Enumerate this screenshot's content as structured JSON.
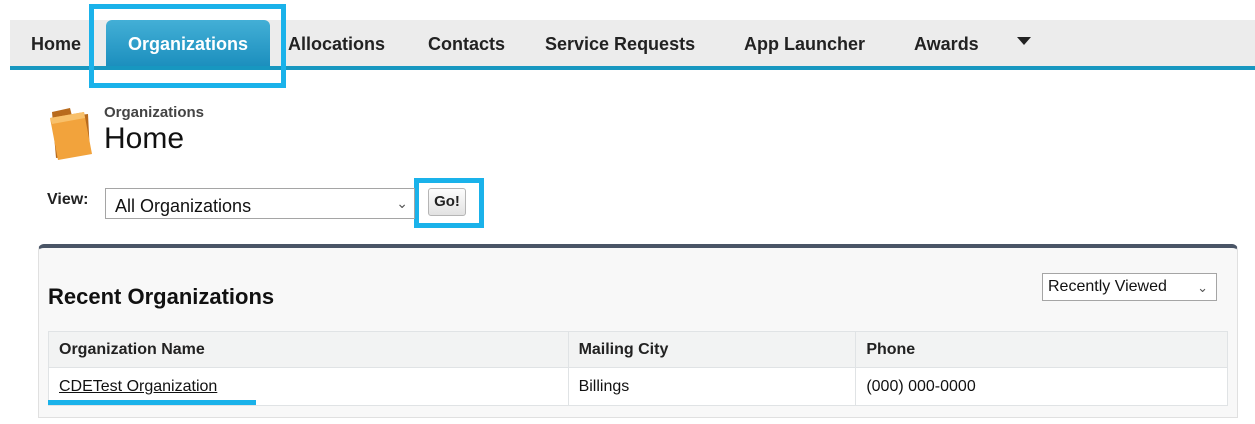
{
  "nav": {
    "tabs": [
      {
        "label": "Home"
      },
      {
        "label": "Organizations",
        "active": true
      },
      {
        "label": "Allocations"
      },
      {
        "label": "Contacts"
      },
      {
        "label": "Service Requests"
      },
      {
        "label": "App Launcher"
      },
      {
        "label": "Awards"
      }
    ],
    "more_icon": "caret-down-icon"
  },
  "header": {
    "breadcrumb": "Organizations",
    "title": "Home",
    "icon": "folder-icon"
  },
  "view": {
    "label": "View:",
    "selected": "All Organizations",
    "go_label": "Go!"
  },
  "recent": {
    "title": "Recent Organizations",
    "sort_selected": "Recently Viewed",
    "columns": [
      "Organization Name",
      "Mailing City",
      "Phone"
    ],
    "rows": [
      {
        "name": "CDETest Organization",
        "city": "Billings",
        "phone": "(000) 000-0000"
      }
    ]
  },
  "colors": {
    "accent": "#1797c0",
    "highlight": "#1ab2ea",
    "panel_border": "#4a5566"
  }
}
